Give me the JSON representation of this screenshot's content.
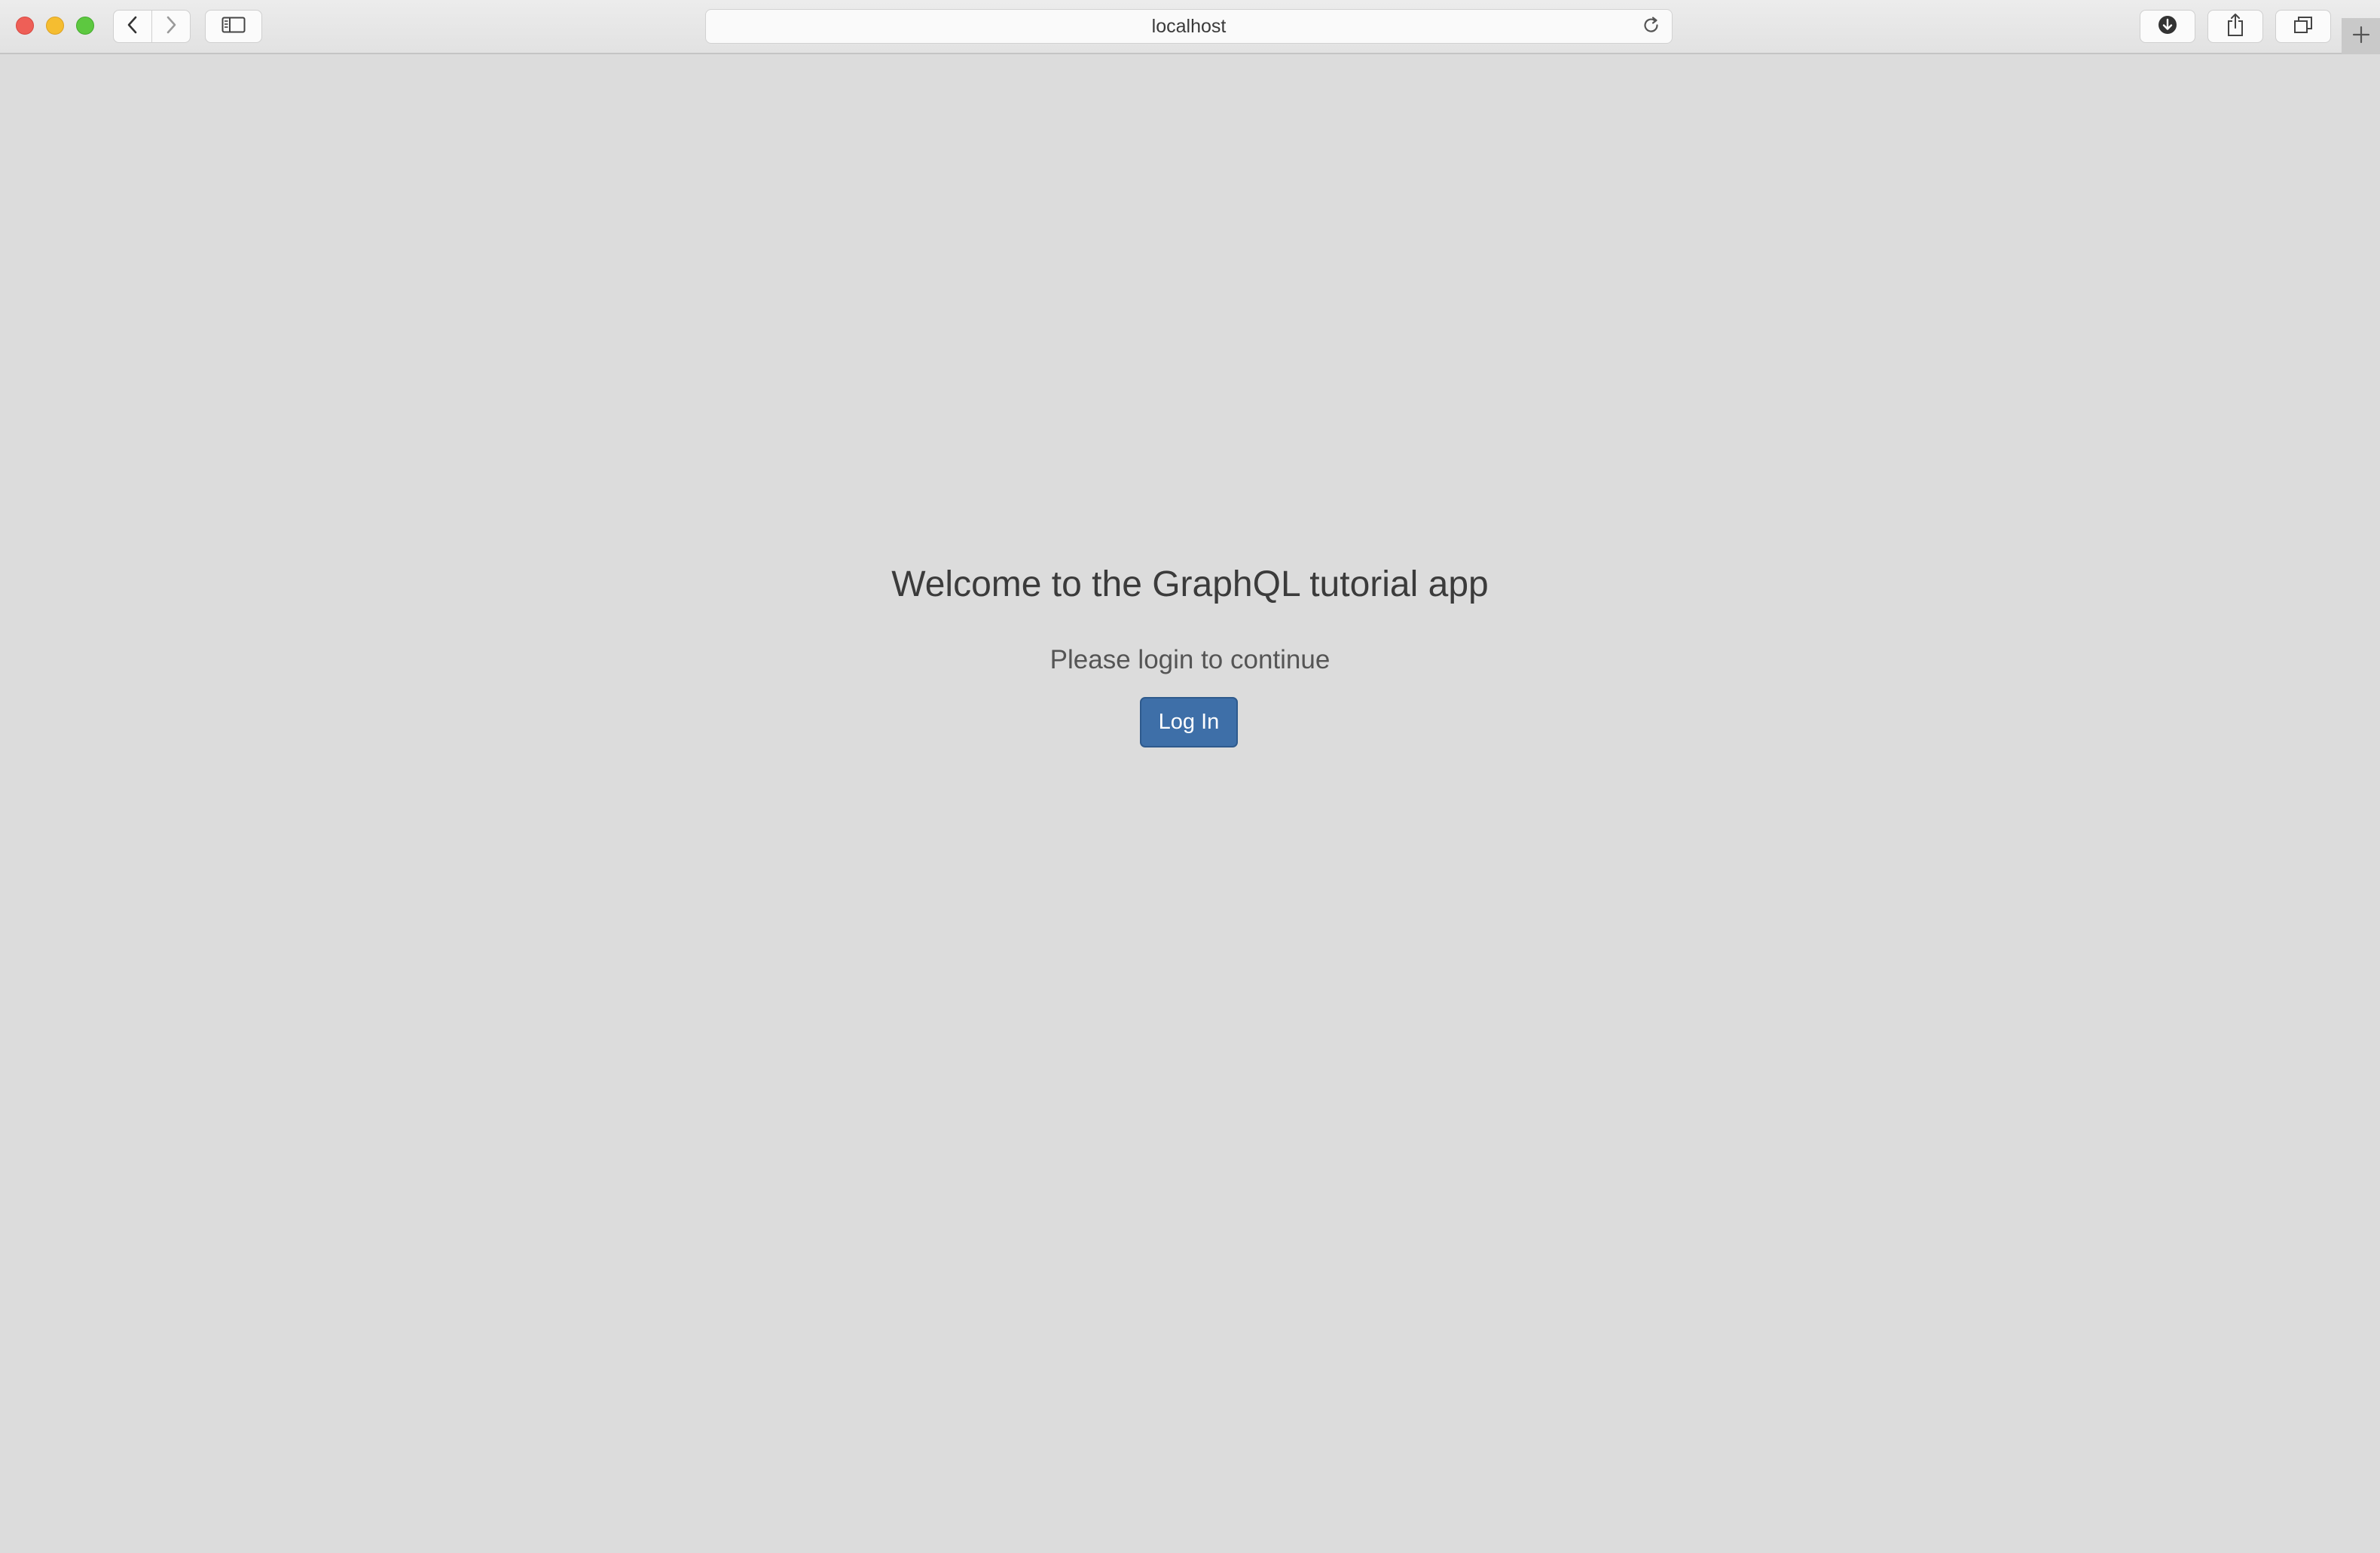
{
  "browser": {
    "address": "localhost",
    "icons": {
      "back": "chevron-left-icon",
      "forward": "chevron-right-icon",
      "sidebar": "sidebar-icon",
      "reload": "reload-icon",
      "download": "download-icon",
      "share": "share-icon",
      "tabs": "tab-overview-icon",
      "new_tab": "plus-icon"
    }
  },
  "page": {
    "welcome": "Welcome to the GraphQL tutorial app",
    "subtitle": "Please login to continue",
    "login_label": "Log In"
  },
  "colors": {
    "page_background": "#dcdcdc",
    "button_primary": "#3e6fa8"
  }
}
